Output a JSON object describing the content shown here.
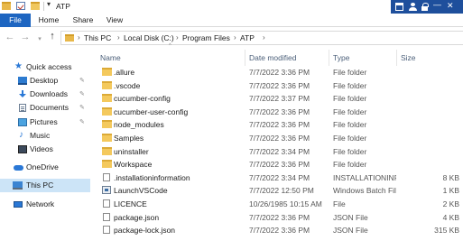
{
  "window": {
    "title": "ATP"
  },
  "ribbon": {
    "tabs": [
      {
        "label": "File"
      },
      {
        "label": "Home"
      },
      {
        "label": "Share"
      },
      {
        "label": "View"
      }
    ]
  },
  "address": {
    "breadcrumbs": [
      "This PC",
      "Local Disk (C:)",
      "Program Files",
      "ATP"
    ]
  },
  "nav_pane": {
    "items": [
      {
        "label": "Quick access",
        "icon": "star-icon"
      },
      {
        "label": "Desktop",
        "icon": "desktop-icon",
        "pinned": true
      },
      {
        "label": "Downloads",
        "icon": "download-icon",
        "pinned": true
      },
      {
        "label": "Documents",
        "icon": "documents-icon",
        "pinned": true
      },
      {
        "label": "Pictures",
        "icon": "pictures-icon",
        "pinned": true
      },
      {
        "label": "Music",
        "icon": "music-icon"
      },
      {
        "label": "Videos",
        "icon": "videos-icon"
      },
      {
        "label": "OneDrive",
        "icon": "cloud-icon"
      },
      {
        "label": "This PC",
        "icon": "computer-icon",
        "selected": true
      },
      {
        "label": "Network",
        "icon": "network-icon"
      }
    ]
  },
  "file_list": {
    "columns": [
      "Name",
      "Date modified",
      "Type",
      "Size"
    ],
    "rows": [
      {
        "name": ".allure",
        "date": "7/7/2022 3:36 PM",
        "type": "File folder",
        "size": "",
        "icon": "folder-icon"
      },
      {
        "name": ".vscode",
        "date": "7/7/2022 3:36 PM",
        "type": "File folder",
        "size": "",
        "icon": "folder-icon"
      },
      {
        "name": "cucumber-config",
        "date": "7/7/2022 3:37 PM",
        "type": "File folder",
        "size": "",
        "icon": "folder-icon"
      },
      {
        "name": "cucumber-user-config",
        "date": "7/7/2022 3:36 PM",
        "type": "File folder",
        "size": "",
        "icon": "folder-icon"
      },
      {
        "name": "node_modules",
        "date": "7/7/2022 3:36 PM",
        "type": "File folder",
        "size": "",
        "icon": "folder-icon"
      },
      {
        "name": "Samples",
        "date": "7/7/2022 3:36 PM",
        "type": "File folder",
        "size": "",
        "icon": "folder-icon"
      },
      {
        "name": "uninstaller",
        "date": "7/7/2022 3:34 PM",
        "type": "File folder",
        "size": "",
        "icon": "folder-icon"
      },
      {
        "name": "Workspace",
        "date": "7/7/2022 3:36 PM",
        "type": "File folder",
        "size": "",
        "icon": "folder-icon"
      },
      {
        "name": ".installationinformation",
        "date": "7/7/2022 3:34 PM",
        "type": "INSTALLATIONINF...",
        "size": "8 KB",
        "icon": "file-icon"
      },
      {
        "name": "LaunchVSCode",
        "date": "7/7/2022 12:50 PM",
        "type": "Windows Batch File",
        "size": "1 KB",
        "icon": "batch-file-icon"
      },
      {
        "name": "LICENCE",
        "date": "10/26/1985 10:15 AM",
        "type": "File",
        "size": "2 KB",
        "icon": "file-icon"
      },
      {
        "name": "package.json",
        "date": "7/7/2022 3:36 PM",
        "type": "JSON File",
        "size": "4 KB",
        "icon": "file-icon"
      },
      {
        "name": "package-lock.json",
        "date": "7/7/2022 3:36 PM",
        "type": "JSON File",
        "size": "315 KB",
        "icon": "file-icon"
      }
    ]
  },
  "colors": {
    "file_tab": "#1d65c1",
    "selection": "#cce4f7",
    "folder": "#f4c95d",
    "tray": "#1e4f9c"
  }
}
